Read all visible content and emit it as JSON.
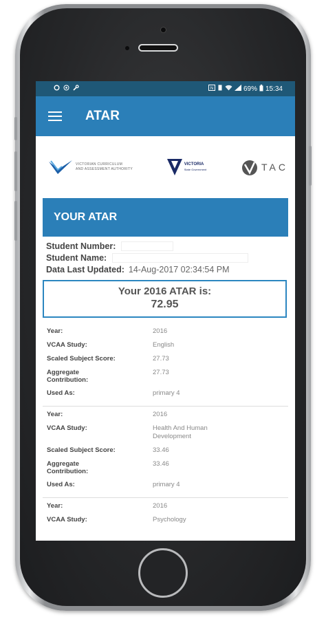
{
  "status_bar": {
    "battery": "69%",
    "time": "15:34"
  },
  "app_bar": {
    "title": "ATAR"
  },
  "logos": {
    "vcaa_line1": "VICTORIAN CURRICULUM",
    "vcaa_line2": "AND ASSESSMENT AUTHORITY",
    "vic_line1": "VICTORIA",
    "vic_line2": "State Government",
    "vtac_text": "TAC"
  },
  "section": {
    "title": "YOUR ATAR"
  },
  "student": {
    "number_label": "Student Number:",
    "name_label": "Student Name:",
    "updated_label": "Data Last Updated:",
    "updated_value": "14-Aug-2017 02:34:54 PM"
  },
  "atar": {
    "heading": "Your 2016 ATAR is:",
    "value": "72.95"
  },
  "labels": {
    "year": "Year:",
    "study": "VCAA Study:",
    "scaled": "Scaled Subject Score:",
    "aggregate": "Aggregate Contribution:",
    "used_as": "Used As:"
  },
  "subjects": [
    {
      "year": "2016",
      "study": "English",
      "scaled": "27.73",
      "aggregate": "27.73",
      "used_as": "primary 4"
    },
    {
      "year": "2016",
      "study": "Health And Human Development",
      "scaled": "33.46",
      "aggregate": "33.46",
      "used_as": "primary 4"
    },
    {
      "year": "2016",
      "study": "Psychology"
    }
  ],
  "colors": {
    "status_bar": "#1f5877",
    "app_bar": "#2b7fb8",
    "atar_border": "#2b86c0"
  }
}
